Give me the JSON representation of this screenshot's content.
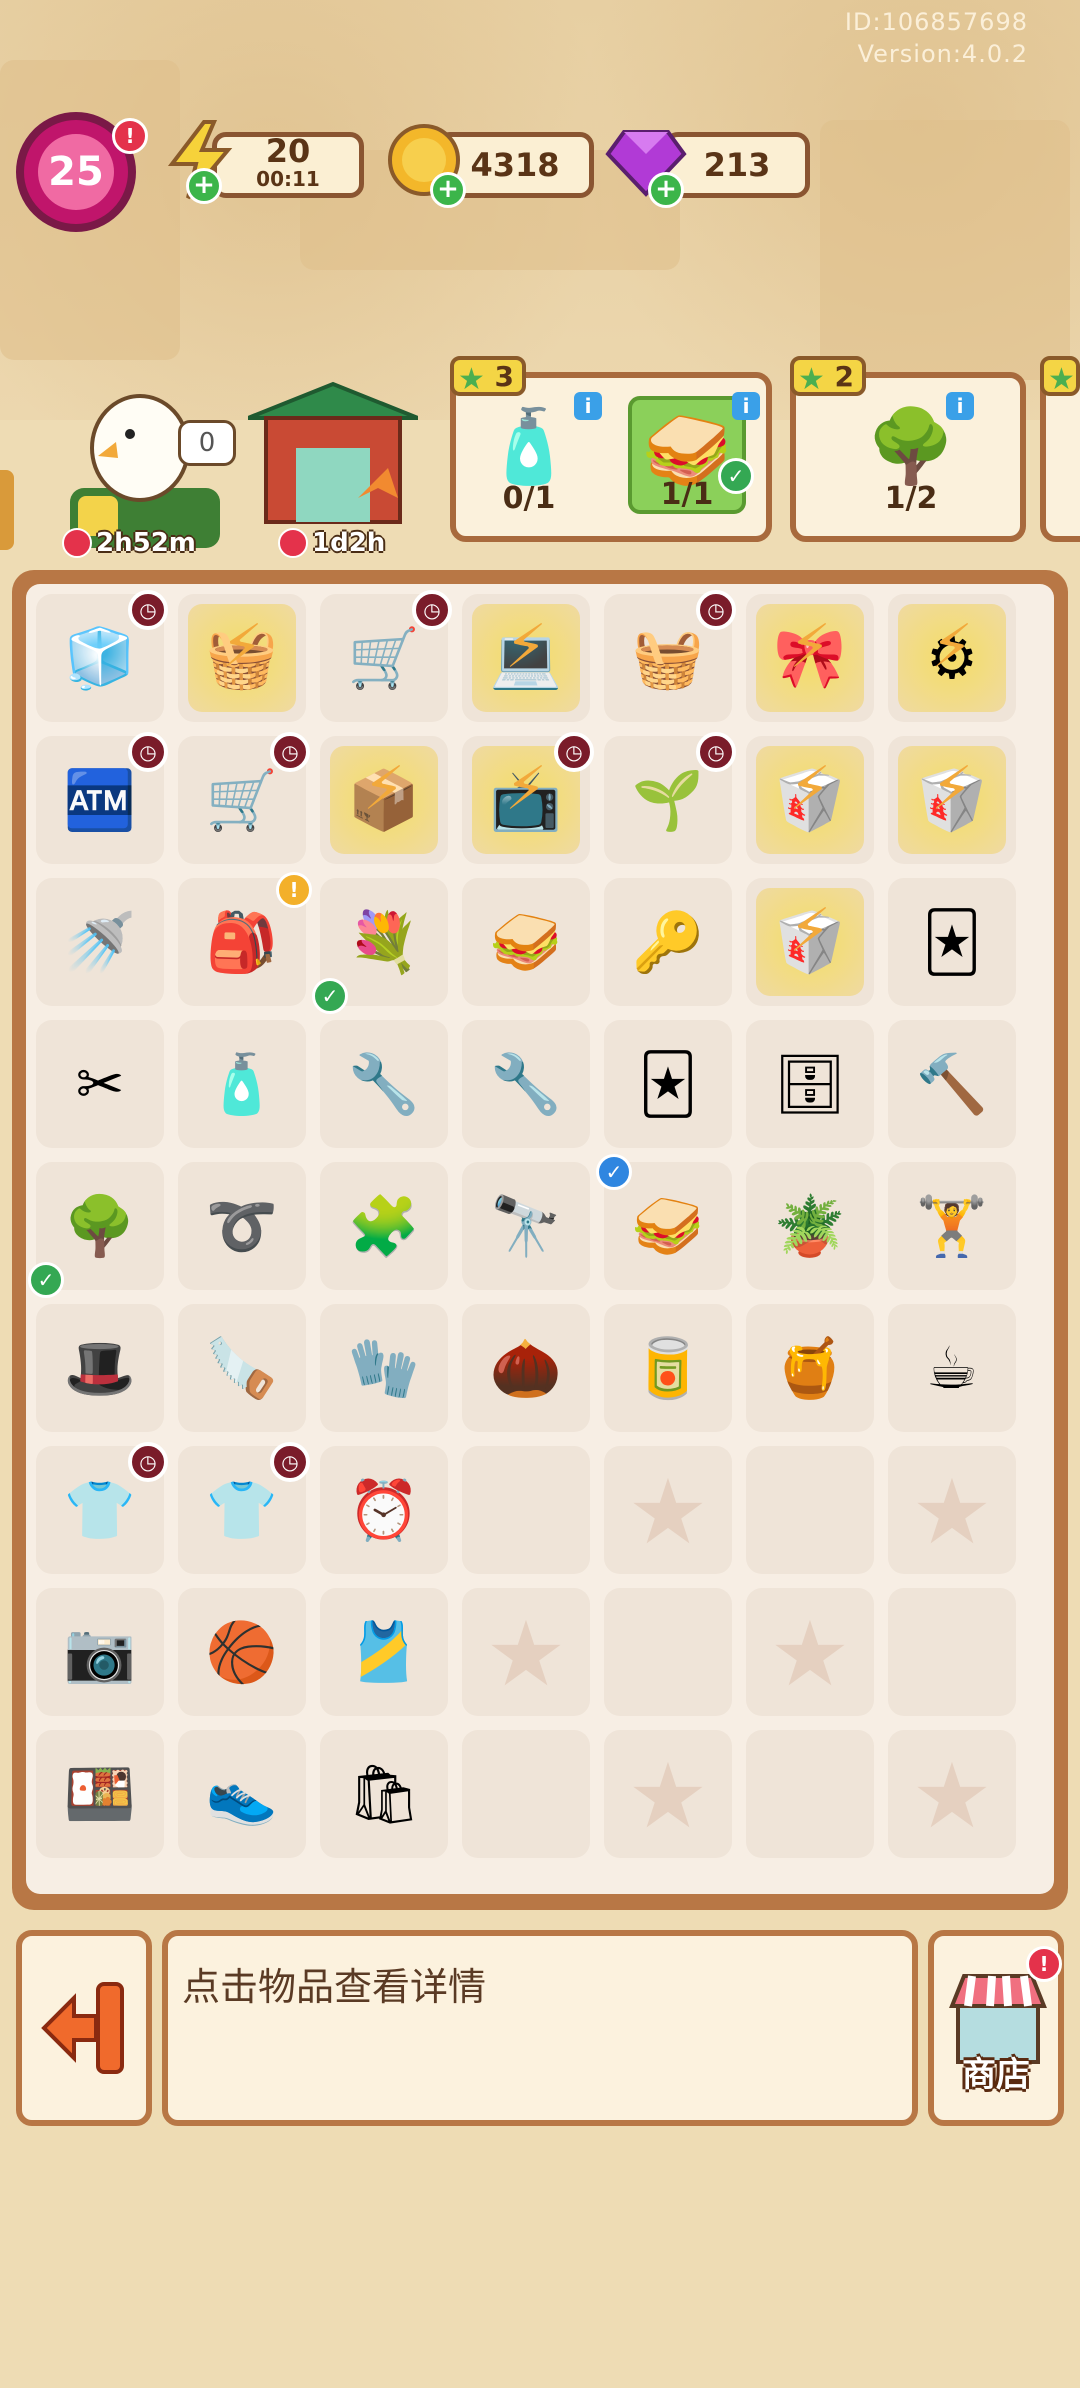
{
  "header": {
    "user_id": "ID:106857698",
    "version": "Version:4.0.2"
  },
  "top_bar": {
    "level": "25",
    "level_alert": "!",
    "energy": "20",
    "energy_timer": "00:11",
    "coins": "4318",
    "gems": "213",
    "plus_symbol": "+"
  },
  "producers": {
    "duck_badge": "0",
    "duck_timer": "2h52m",
    "gate_timer": "1d2h"
  },
  "orders": [
    {
      "stars": "3",
      "items": [
        {
          "icon": "milk-bottle-icon",
          "glyph": "🧴",
          "progress": "0/1",
          "done": false
        },
        {
          "icon": "sandwich-icon",
          "glyph": "🥪",
          "progress": "1/1",
          "done": true
        }
      ]
    },
    {
      "stars": "2",
      "items": [
        {
          "icon": "potted-tree-icon",
          "glyph": "🌳",
          "progress": "1/2",
          "done": false
        }
      ]
    }
  ],
  "board": {
    "rows": [
      [
        {
          "n": "pink-fridge",
          "g": "🧊",
          "clock": true
        },
        {
          "n": "green-box",
          "g": "🧺",
          "locked": true
        },
        {
          "n": "cart-blue",
          "g": "🛒",
          "clock": true
        },
        {
          "n": "laptop",
          "g": "💻",
          "locked": true
        },
        {
          "n": "shopping-basket",
          "g": "🧺",
          "clock": true
        },
        {
          "n": "wreath",
          "g": "🎀",
          "locked": true
        },
        {
          "n": "green-machine",
          "g": "⚙",
          "locked": true
        }
      ],
      [
        {
          "n": "pink-vending",
          "g": "🏧",
          "clock": true
        },
        {
          "n": "yellow-cart",
          "g": "🛒",
          "clock": true
        },
        {
          "n": "blue-tray",
          "g": "📦",
          "locked": true
        },
        {
          "n": "tv",
          "g": "📺",
          "locked": true,
          "clock": true
        },
        {
          "n": "sprout-cup",
          "g": "🌱",
          "clock": true
        },
        {
          "n": "takeout-box",
          "g": "🥡",
          "locked": true
        },
        {
          "n": "takeout-box-2",
          "g": "🥡",
          "locked": true
        }
      ],
      [
        {
          "n": "watering-can",
          "g": "🚿"
        },
        {
          "n": "pink-backpack",
          "g": "🎒",
          "alert": true
        },
        {
          "n": "flower-bouquet",
          "g": "💐",
          "check": true
        },
        {
          "n": "sandwich",
          "g": "🥪"
        },
        {
          "n": "key-tag",
          "g": "🔑"
        },
        {
          "n": "takeout-box-3",
          "g": "🥡",
          "locked": true
        },
        {
          "n": "photo-cards",
          "g": "🃏"
        }
      ],
      [
        {
          "n": "scissors",
          "g": "✂"
        },
        {
          "n": "spray-bottle",
          "g": "🧴"
        },
        {
          "n": "green-drill",
          "g": "🔧"
        },
        {
          "n": "wrench",
          "g": "🔧"
        },
        {
          "n": "card-pack",
          "g": "🃏"
        },
        {
          "n": "drawer-cabinet",
          "g": "🗄"
        },
        {
          "n": "power-drill",
          "g": "🔨"
        }
      ],
      [
        {
          "n": "potted-tree",
          "g": "🌳",
          "check": true
        },
        {
          "n": "jump-rope",
          "g": "➰"
        },
        {
          "n": "puzzle-piece",
          "g": "🧩"
        },
        {
          "n": "telescope",
          "g": "🔭"
        },
        {
          "n": "toast-sandwich",
          "g": "🥪",
          "blue_check": true
        },
        {
          "n": "potted-sprout",
          "g": "🪴"
        },
        {
          "n": "dumbbell",
          "g": "🏋"
        }
      ],
      [
        {
          "n": "blue-hat",
          "g": "🎩"
        },
        {
          "n": "hand-saw",
          "g": "🪚"
        },
        {
          "n": "garden-glove",
          "g": "🧤"
        },
        {
          "n": "seed-bag",
          "g": "🌰"
        },
        {
          "n": "soda-can",
          "g": "🥫"
        },
        {
          "n": "honey-jar",
          "g": "🍯"
        },
        {
          "n": "coffee-cup",
          "g": "☕"
        }
      ],
      [
        {
          "n": "jersey-stack",
          "g": "👕",
          "clock": true
        },
        {
          "n": "jersey-stack-2",
          "g": "👕",
          "clock": true
        },
        {
          "n": "digital-clock",
          "g": "⏰"
        },
        {
          "n": "empty"
        },
        {
          "n": "star"
        },
        {
          "n": "empty"
        },
        {
          "n": "star"
        }
      ],
      [
        {
          "n": "camera",
          "g": "📷"
        },
        {
          "n": "basketball-machine",
          "g": "🏀"
        },
        {
          "n": "basketball-jersey",
          "g": "🎽"
        },
        {
          "n": "star"
        },
        {
          "n": "empty"
        },
        {
          "n": "star"
        },
        {
          "n": "empty"
        }
      ],
      [
        {
          "n": "pink-lunchbox",
          "g": "🍱"
        },
        {
          "n": "sneakers",
          "g": "👟"
        },
        {
          "n": "paper-bag",
          "g": "🛍"
        },
        {
          "n": "empty"
        },
        {
          "n": "star"
        },
        {
          "n": "empty"
        },
        {
          "n": "star"
        }
      ]
    ]
  },
  "bottom": {
    "description": "点击物品查看详情",
    "shop_label": "商店",
    "shop_alert": "!"
  }
}
